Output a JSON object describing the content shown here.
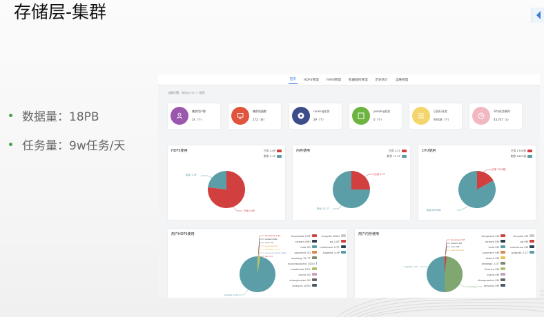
{
  "slide": {
    "title": "存储层-集群",
    "bullets": [
      "数据量：18PB",
      "任务量：9w任务/天"
    ]
  },
  "colors": {
    "accent": "#3a7fd5",
    "bullet": "#4aa04a",
    "used": "#d23f3f",
    "free": "#5b9ea8"
  },
  "app": {
    "nav": [
      "首页",
      "HDFS管理",
      "YARN管理",
      "机器授权管理",
      "历史统计",
      "运维管理"
    ],
    "active_tab": "首页",
    "breadcrumb": {
      "label": "当前位置：",
      "path": "集群portal",
      "sep": " > ",
      "page": "首页"
    },
    "kpis": [
      {
        "label": "集群用户数",
        "value": "1k（个）",
        "color": "#9b57ad",
        "icon": "user-icon"
      },
      {
        "label": "集群机器数",
        "value": "172（台）",
        "color": "#e0533d",
        "icon": "monitor-icon"
      },
      {
        "label": "running任务",
        "value": "29（个）",
        "color": "#3d4d8a",
        "icon": "disc-icon"
      },
      {
        "label": "pending任务",
        "value": "0（个）",
        "color": "#6cb33f",
        "icon": "square-icon"
      },
      {
        "label": "已执行任务",
        "value": "94038（个）",
        "color": "#f4d56b",
        "icon": "list-icon"
      },
      {
        "label": "平均任务耗时",
        "value": "43,747（s）",
        "color": "#f2b8c2",
        "icon": "clock-icon"
      }
    ],
    "hdfs": {
      "title": "HDFS使用",
      "legend": [
        "已用 4.6P",
        "剩余 1.4P"
      ],
      "labels": [
        "剩余 1.4P",
        "已用 4.6P"
      ],
      "used_fraction": 0.77
    },
    "memory": {
      "title": "内存使用",
      "legend": [
        "已用 4.2T",
        "剩余 12.4T"
      ],
      "labels": [
        "已用 4.2T",
        "剩余 12.2T"
      ],
      "used_fraction": 0.25
    },
    "cpu": {
      "title": "CPU使用",
      "legend": [
        "已用 1700核",
        "剩余 8467核"
      ],
      "labels": [
        "已用 1700核",
        "剩余 8500核"
      ],
      "used_fraction": 0.17
    },
    "user_hdfs": {
      "title": "用户HDFS使用",
      "legend_col1": [
        "tianqiweb 2.8T",
        "stream 89G",
        "redo 0G",
        "payment 2G",
        "strategy 31.7T",
        "nouveauquant 100G",
        "newhouse 10%",
        "mario 0G",
        "zhaoguoxian 0G",
        "analysis 183G"
      ],
      "legend_col2": [
        "rempfat 380G",
        "qa 2.8T",
        "newhouse 0.2T",
        "bigdata 4.4P"
      ],
      "main_label": "bigdata 4.4P"
    },
    "user_mem": {
      "title": "用户内存使用",
      "legend_col1": [
        "tianqiweb 0M",
        "stream 0M",
        "redo 0M",
        "payment 0M",
        "search 0M",
        "strategy 2.0T",
        "finance 0M",
        "mario 0M",
        "zhaoguoxian 0M",
        "analysis 0M"
      ],
      "legend_col2": [
        "rempfat 0M",
        "qa 0M",
        "newhouse 0M",
        "bigdata 2.1T"
      ],
      "main_label": "bigdata 2.0T"
    }
  }
}
